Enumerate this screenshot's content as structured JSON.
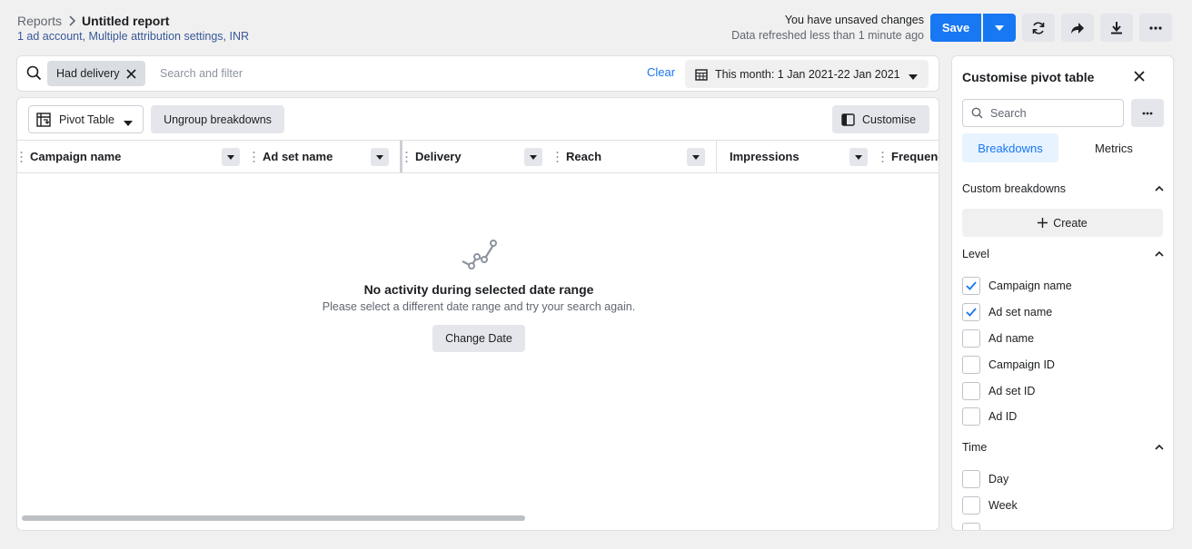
{
  "header": {
    "breadcrumb_root": "Reports",
    "breadcrumb_current": "Untitled report",
    "subtitle": "1 ad account, Multiple attribution settings, INR",
    "unsaved": "You have unsaved changes",
    "refreshed": "Data refreshed less than 1 minute ago",
    "save_label": "Save"
  },
  "filter": {
    "chip_label": "Had delivery",
    "placeholder": "Search and filter",
    "clear_label": "Clear",
    "date_range": "This month: 1 Jan 2021-22 Jan 2021"
  },
  "toolbar": {
    "pivot_label": "Pivot Table",
    "ungroup_label": "Ungroup breakdowns",
    "customise_label": "Customise"
  },
  "columns": [
    "Campaign name",
    "Ad set name",
    "Delivery",
    "Reach",
    "Impressions",
    "Frequency"
  ],
  "empty": {
    "title": "No activity during selected date range",
    "message": "Please select a different date range and try your search again.",
    "button": "Change Date"
  },
  "side": {
    "title": "Customise pivot table",
    "search_placeholder": "Search",
    "tabs": [
      "Breakdowns",
      "Metrics"
    ],
    "custom_section": "Custom breakdowns",
    "create_label": "Create",
    "level_section": "Level",
    "level_items": [
      {
        "label": "Campaign name",
        "checked": true
      },
      {
        "label": "Ad set name",
        "checked": true
      },
      {
        "label": "Ad name",
        "checked": false
      },
      {
        "label": "Campaign ID",
        "checked": false
      },
      {
        "label": "Ad set ID",
        "checked": false
      },
      {
        "label": "Ad ID",
        "checked": false
      }
    ],
    "time_section": "Time",
    "time_items": [
      {
        "label": "Day",
        "checked": false
      },
      {
        "label": "Week",
        "checked": false
      }
    ]
  },
  "colors": {
    "accent": "#1877f2",
    "background": "#f0f0f0"
  }
}
